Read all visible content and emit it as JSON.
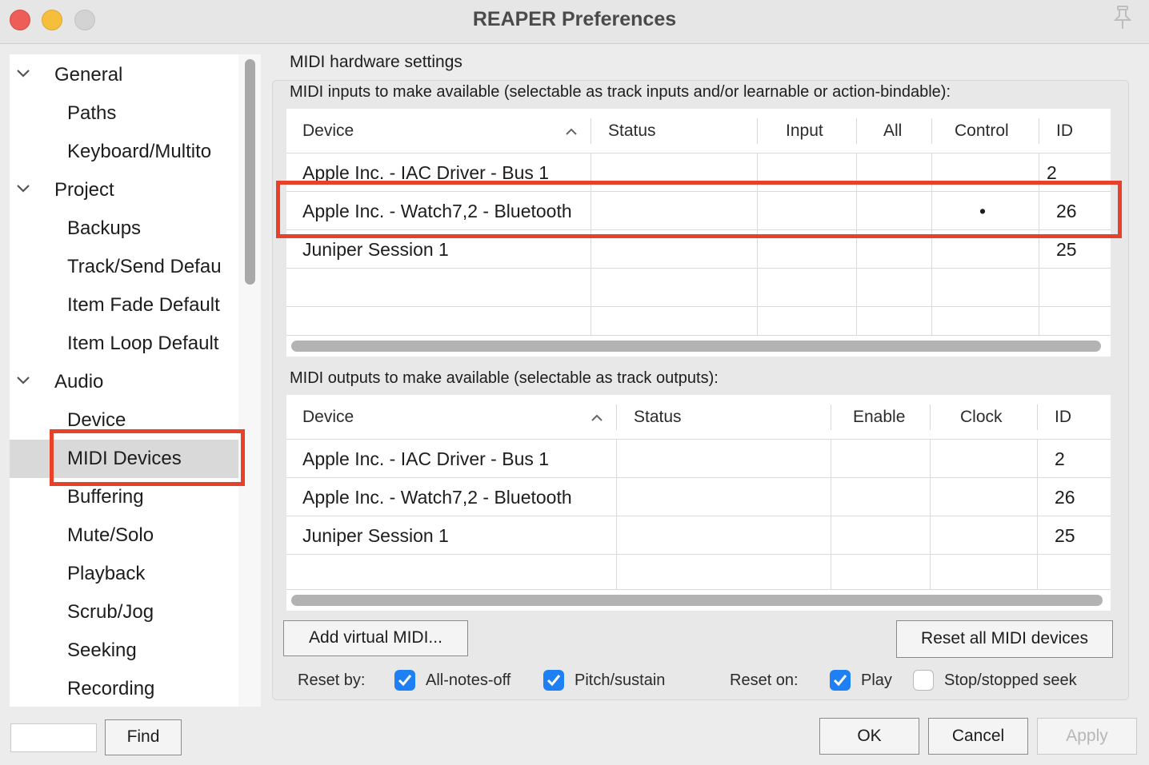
{
  "window": {
    "title": "REAPER Preferences"
  },
  "sidebar": {
    "items": [
      {
        "label": "General",
        "level": 0,
        "expanded": true
      },
      {
        "label": "Paths",
        "level": 1
      },
      {
        "label": "Keyboard/Multito",
        "level": 1
      },
      {
        "label": "Project",
        "level": 0,
        "expanded": true
      },
      {
        "label": "Backups",
        "level": 1
      },
      {
        "label": "Track/Send Defau",
        "level": 1
      },
      {
        "label": "Item Fade Default",
        "level": 1
      },
      {
        "label": "Item Loop Default",
        "level": 1
      },
      {
        "label": "Audio",
        "level": 0,
        "expanded": true
      },
      {
        "label": "Device",
        "level": 1
      },
      {
        "label": "MIDI Devices",
        "level": 1,
        "selected": true
      },
      {
        "label": "Buffering",
        "level": 1
      },
      {
        "label": "Mute/Solo",
        "level": 1
      },
      {
        "label": "Playback",
        "level": 1
      },
      {
        "label": "Scrub/Jog",
        "level": 1
      },
      {
        "label": "Seeking",
        "level": 1
      },
      {
        "label": "Recording",
        "level": 1
      }
    ]
  },
  "search": {
    "value": "",
    "find_label": "Find"
  },
  "main": {
    "section_title": "MIDI hardware settings",
    "inputs": {
      "label": "MIDI inputs to make available (selectable as track inputs and/or learnable or action-bindable):",
      "columns": [
        "Device",
        "Status",
        "Input",
        "All",
        "Control",
        "ID"
      ],
      "rows": [
        {
          "device": "Apple Inc. - IAC Driver - Bus 1",
          "status": "",
          "input": "",
          "all": "",
          "control": "",
          "id": "2"
        },
        {
          "device": "Apple Inc. - Watch7,2 - Bluetooth",
          "status": "",
          "input": "",
          "all": "",
          "control": "•",
          "id": "26"
        },
        {
          "device": "Juniper Session 1",
          "status": "",
          "input": "",
          "all": "",
          "control": "",
          "id": "25"
        }
      ]
    },
    "outputs": {
      "label": "MIDI outputs to make available (selectable as track outputs):",
      "columns": [
        "Device",
        "Status",
        "Enable",
        "Clock",
        "ID"
      ],
      "rows": [
        {
          "device": "Apple Inc. - IAC Driver - Bus 1",
          "status": "",
          "enable": "",
          "clock": "",
          "id": "2"
        },
        {
          "device": "Apple Inc. - Watch7,2 - Bluetooth",
          "status": "",
          "enable": "",
          "clock": "",
          "id": "26"
        },
        {
          "device": "Juniper Session 1",
          "status": "",
          "enable": "",
          "clock": "",
          "id": "25"
        }
      ]
    },
    "add_virtual_label": "Add virtual MIDI...",
    "reset_all_label": "Reset all MIDI devices",
    "reset_by": {
      "label": "Reset by:",
      "options": [
        {
          "label": "All-notes-off",
          "checked": true
        },
        {
          "label": "Pitch/sustain",
          "checked": true
        }
      ]
    },
    "reset_on": {
      "label": "Reset on:",
      "options": [
        {
          "label": "Play",
          "checked": true
        },
        {
          "label": "Stop/stopped seek",
          "checked": false
        }
      ]
    }
  },
  "footer": {
    "ok_label": "OK",
    "cancel_label": "Cancel",
    "apply_label": "Apply"
  },
  "colors": {
    "accent": "#1f7ff5",
    "highlight_box": "#e8412b",
    "selection": "#d9d9d9"
  }
}
